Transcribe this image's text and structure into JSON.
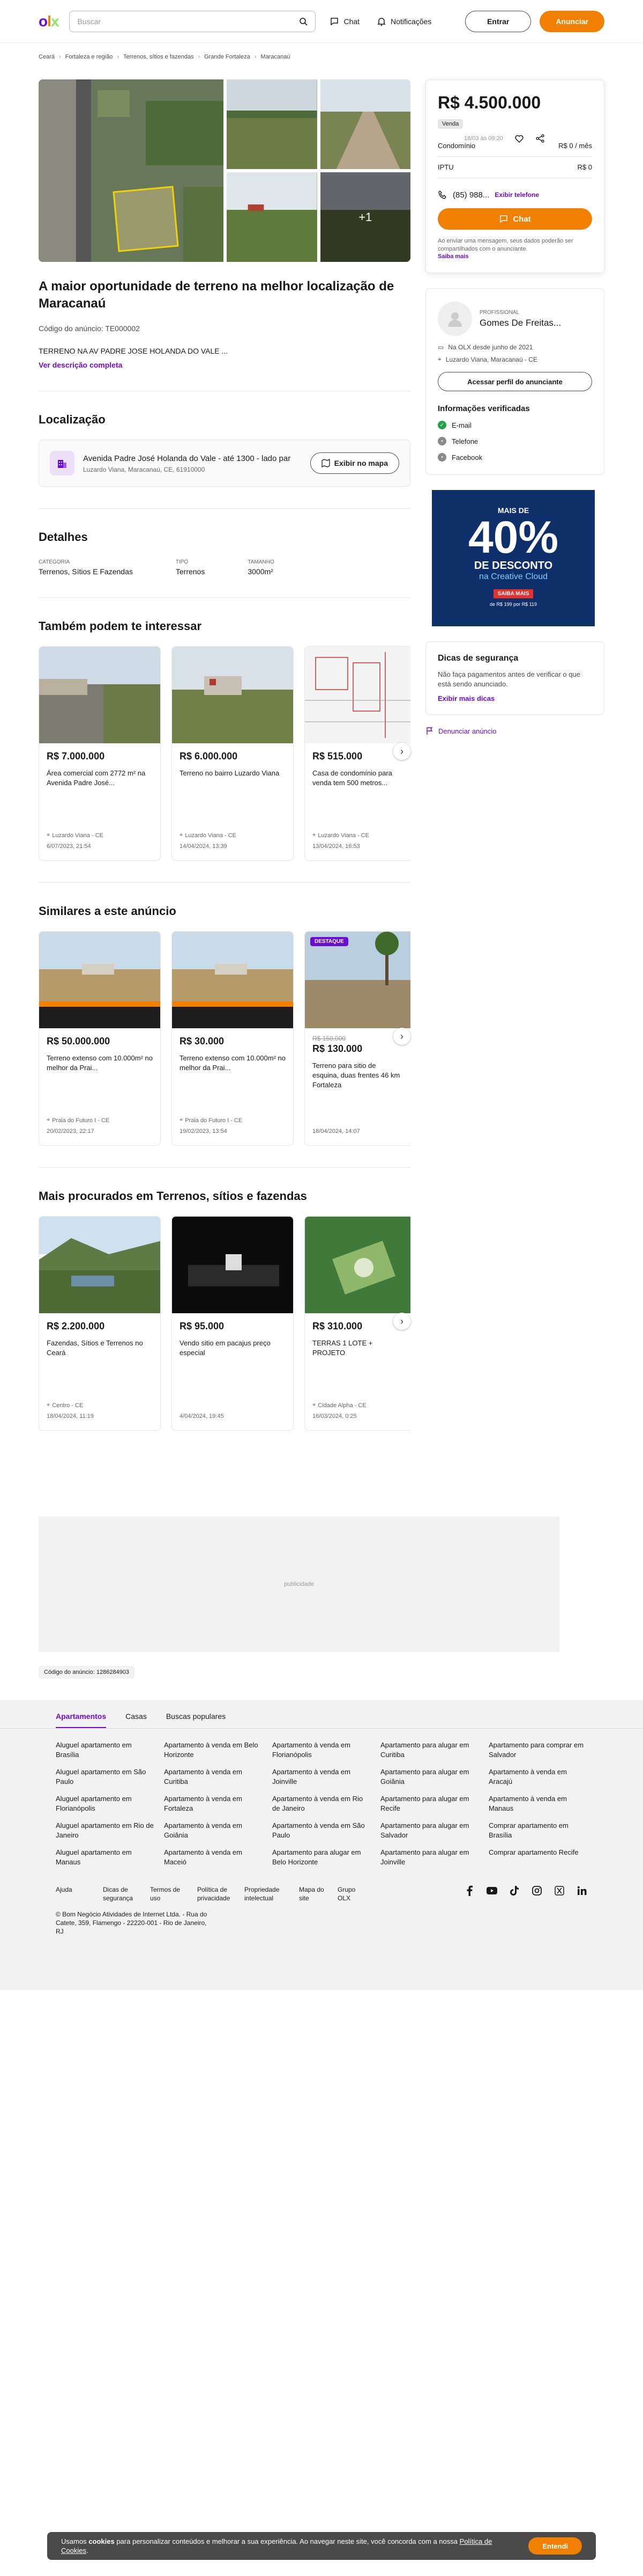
{
  "header": {
    "search_placeholder": "Buscar",
    "chat": "Chat",
    "notifications": "Notificações",
    "login": "Entrar",
    "sell": "Anunciar"
  },
  "breadcrumb": {
    "items": [
      "Ceará",
      "Fortaleza e região",
      "Terrenos, sítios e fazendas",
      "Grande Fortaleza",
      "Maracanaú"
    ],
    "date": "18/03 às 09:20"
  },
  "gallery": {
    "more": "+1"
  },
  "listing": {
    "title": "A maior oportunidade de terreno na melhor localização de Maracanaú",
    "code": "Código do anúncio: TE000002",
    "description": "TERRENO NA AV PADRE JOSE HOLANDA DO VALE ...",
    "more_link": "Ver descrição completa"
  },
  "location": {
    "heading": "Localização",
    "address": "Avenida Padre José Holanda do Vale - até 1300 - lado par",
    "sub": "Luzardo Viana, Maracanaú, CE, 61910000",
    "map_button": "Exibir no mapa"
  },
  "details": {
    "heading": "Detalhes",
    "items": [
      {
        "k": "Categoria",
        "v": "Terrenos, Sítios E Fazendas"
      },
      {
        "k": "Tipo",
        "v": "Terrenos"
      },
      {
        "k": "Tamanho",
        "v": "3000m²"
      }
    ]
  },
  "section1": {
    "heading": "Também podem te interessar",
    "cards": [
      {
        "price": "R$ 7.000.000",
        "title": "Área comercial com 2772 m² na Avenida Padre José...",
        "loc": "Luzardo Viana - CE",
        "date": "6/07/2023, 21:54"
      },
      {
        "price": "R$ 6.000.000",
        "title": "Terreno no bairro Luzardo Viana",
        "loc": "Luzardo Viana - CE",
        "date": "14/04/2024, 13:39"
      },
      {
        "price": "R$ 515.000",
        "title": "Casa de condomínio para venda tem 500 metros...",
        "loc": "Luzardo Viana - CE",
        "date": "13/04/2024, 16:53"
      }
    ]
  },
  "section2": {
    "heading": "Similares a este anúncio",
    "cards": [
      {
        "price": "R$ 50.000.000",
        "title": "Terreno extenso com 10.000m² no melhor da Prai...",
        "loc": "Praia do Futuro I - CE",
        "date": "20/02/2023, 22:17"
      },
      {
        "price": "R$ 30.000",
        "title": "Terreno extenso com 10.000m² no melhor da Prai...",
        "loc": "Praia do Futuro I - CE",
        "date": "19/02/2023, 13:54"
      },
      {
        "badge": "DESTAQUE",
        "oldprice": "R$ 150.000",
        "price": "R$ 130.000",
        "title": "Terreno para sitio de esquina, duas frentes 46 km Fortaleza",
        "loc": "",
        "date": "18/04/2024, 14:07"
      }
    ]
  },
  "section3": {
    "heading": "Mais procurados em Terrenos, sítios e fazendas",
    "cards": [
      {
        "price": "R$ 2.200.000",
        "title": "Fazendas, Sítios e Terrenos no Ceará",
        "loc": "Centro - CE",
        "date": "18/04/2024, 11:19"
      },
      {
        "price": "R$ 95.000",
        "title": "Vendo sitio em pacajus preço especial",
        "loc": "",
        "date": "4/04/2024, 19:45"
      },
      {
        "price": "R$ 310.000",
        "title": "TERRAS 1 LOTE + PROJETO",
        "loc": "Cidade Alpha - CE",
        "date": "16/03/2024, 0:25"
      }
    ]
  },
  "sidebar": {
    "price": "R$ 4.500.000",
    "tag": "Venda",
    "rows": [
      {
        "k": "Condomínio",
        "v": "R$ 0 / mês"
      },
      {
        "k": "IPTU",
        "v": "R$ 0"
      }
    ],
    "phone": "(85) 988...",
    "phone_link": "Exibir telefone",
    "chat": "Chat",
    "note": "Ao enviar uma mensagem, seus dados poderão ser compartilhados com o anunciante.",
    "note_link": "Saiba mais"
  },
  "seller": {
    "label": "Profissional",
    "name": "Gomes De Freitas...",
    "since": "Na OLX desde junho de 2021",
    "place": "Luzardo Viana, Maracanaú - CE",
    "profile": "Acessar perfil do anunciante",
    "verified_h": "Informações verificadas",
    "verified": [
      "E-mail",
      "Telefone",
      "Facebook"
    ]
  },
  "ad": {
    "top": "MAIS DE",
    "big": "40%",
    "sub": "DE DESCONTO",
    "sub2": "na Creative Cloud",
    "cta": "SAIBA MAIS",
    "small": "de R$ 199 por R$ 119"
  },
  "tips": {
    "heading": "Dicas de segurança",
    "text": "Não faça pagamentos antes de verificar o que está sendo anunciado.",
    "link": "Exibir mais dicas"
  },
  "report": "Denunciar anúncio",
  "pub": "publicidade",
  "adcode": "Código do anúncio: 1286284903",
  "footer": {
    "tabs": [
      "Apartamentos",
      "Casas",
      "Buscas populares"
    ],
    "links": [
      "Aluguel apartamento em Brasília",
      "Apartamento à venda em Belo Horizonte",
      "Apartamento à venda em Florianópolis",
      "Apartamento para alugar em Curitiba",
      "Apartamento para comprar em Salvador",
      "Aluguel apartamento em São Paulo",
      "Apartamento à venda em Curitiba",
      "Apartamento à venda em Joinville",
      "Apartamento para alugar em Goiânia",
      "Apartamento à venda em Aracajú",
      "Aluguel apartamento em Florianópolis",
      "Apartamento à venda em Fortaleza",
      "Apartamento à venda em Rio de Janeiro",
      "Apartamento para alugar em Recife",
      "Apartamento à venda em Manaus",
      "Aluguel apartamento em Rio de Janeiro",
      "Apartamento à venda em Goiânia",
      "Apartamento à venda em São Paulo",
      "Apartamento para alugar em Salvador",
      "Comprar apartamento em Brasília",
      "Aluguel apartamento em Manaus",
      "Apartamento à venda em Maceió",
      "Apartamento para alugar em Belo Horizonte",
      "Apartamento para alugar em Joinville",
      "Comprar apartamento Recife"
    ],
    "bottom": [
      "Ajuda",
      "Dicas de segurança",
      "Termos de uso",
      "Política de privacidade",
      "Propriedade intelectual",
      "Mapa do site",
      "Grupo OLX"
    ],
    "copyright": "© Bom Negócio Atividades de Internet Ltda. - Rua do Catete, 359, Flamengo - 22220-001 - Rio de Janeiro, RJ"
  },
  "cookie": {
    "text_a": "Usamos ",
    "text_b": "cookies",
    "text_c": " para personalizar conteúdos e melhorar a sua experiência. Ao navegar neste site, você concorda com a nossa ",
    "link": "Política de Cookies",
    "text_d": ".",
    "button": "Entendi"
  },
  "colors": {
    "brand_purple": "#6e0ad6",
    "brand_orange": "#f28000",
    "brand_green": "#8ce563"
  }
}
